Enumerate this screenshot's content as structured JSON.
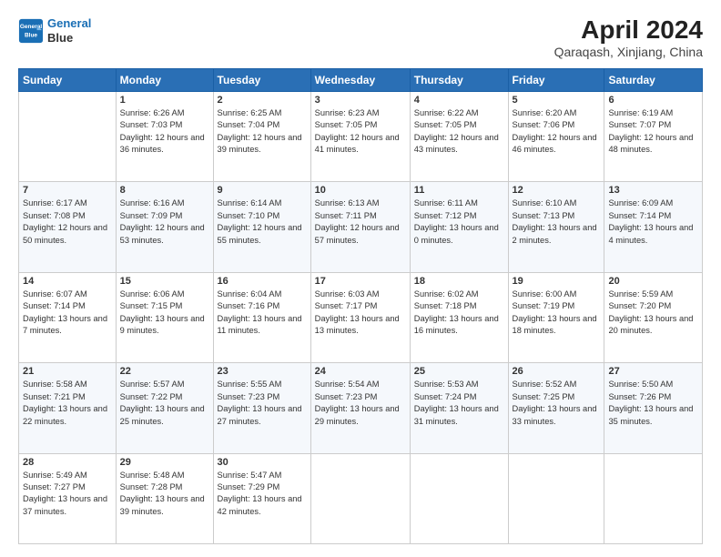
{
  "header": {
    "logo_line1": "General",
    "logo_line2": "Blue",
    "title": "April 2024",
    "subtitle": "Qaraqash, Xinjiang, China"
  },
  "days_of_week": [
    "Sunday",
    "Monday",
    "Tuesday",
    "Wednesday",
    "Thursday",
    "Friday",
    "Saturday"
  ],
  "weeks": [
    [
      {
        "day": null
      },
      {
        "day": 1,
        "sunrise": "6:26 AM",
        "sunset": "7:03 PM",
        "daylight": "12 hours and 36 minutes."
      },
      {
        "day": 2,
        "sunrise": "6:25 AM",
        "sunset": "7:04 PM",
        "daylight": "12 hours and 39 minutes."
      },
      {
        "day": 3,
        "sunrise": "6:23 AM",
        "sunset": "7:05 PM",
        "daylight": "12 hours and 41 minutes."
      },
      {
        "day": 4,
        "sunrise": "6:22 AM",
        "sunset": "7:05 PM",
        "daylight": "12 hours and 43 minutes."
      },
      {
        "day": 5,
        "sunrise": "6:20 AM",
        "sunset": "7:06 PM",
        "daylight": "12 hours and 46 minutes."
      },
      {
        "day": 6,
        "sunrise": "6:19 AM",
        "sunset": "7:07 PM",
        "daylight": "12 hours and 48 minutes."
      }
    ],
    [
      {
        "day": 7,
        "sunrise": "6:17 AM",
        "sunset": "7:08 PM",
        "daylight": "12 hours and 50 minutes."
      },
      {
        "day": 8,
        "sunrise": "6:16 AM",
        "sunset": "7:09 PM",
        "daylight": "12 hours and 53 minutes."
      },
      {
        "day": 9,
        "sunrise": "6:14 AM",
        "sunset": "7:10 PM",
        "daylight": "12 hours and 55 minutes."
      },
      {
        "day": 10,
        "sunrise": "6:13 AM",
        "sunset": "7:11 PM",
        "daylight": "12 hours and 57 minutes."
      },
      {
        "day": 11,
        "sunrise": "6:11 AM",
        "sunset": "7:12 PM",
        "daylight": "13 hours and 0 minutes."
      },
      {
        "day": 12,
        "sunrise": "6:10 AM",
        "sunset": "7:13 PM",
        "daylight": "13 hours and 2 minutes."
      },
      {
        "day": 13,
        "sunrise": "6:09 AM",
        "sunset": "7:14 PM",
        "daylight": "13 hours and 4 minutes."
      }
    ],
    [
      {
        "day": 14,
        "sunrise": "6:07 AM",
        "sunset": "7:14 PM",
        "daylight": "13 hours and 7 minutes."
      },
      {
        "day": 15,
        "sunrise": "6:06 AM",
        "sunset": "7:15 PM",
        "daylight": "13 hours and 9 minutes."
      },
      {
        "day": 16,
        "sunrise": "6:04 AM",
        "sunset": "7:16 PM",
        "daylight": "13 hours and 11 minutes."
      },
      {
        "day": 17,
        "sunrise": "6:03 AM",
        "sunset": "7:17 PM",
        "daylight": "13 hours and 13 minutes."
      },
      {
        "day": 18,
        "sunrise": "6:02 AM",
        "sunset": "7:18 PM",
        "daylight": "13 hours and 16 minutes."
      },
      {
        "day": 19,
        "sunrise": "6:00 AM",
        "sunset": "7:19 PM",
        "daylight": "13 hours and 18 minutes."
      },
      {
        "day": 20,
        "sunrise": "5:59 AM",
        "sunset": "7:20 PM",
        "daylight": "13 hours and 20 minutes."
      }
    ],
    [
      {
        "day": 21,
        "sunrise": "5:58 AM",
        "sunset": "7:21 PM",
        "daylight": "13 hours and 22 minutes."
      },
      {
        "day": 22,
        "sunrise": "5:57 AM",
        "sunset": "7:22 PM",
        "daylight": "13 hours and 25 minutes."
      },
      {
        "day": 23,
        "sunrise": "5:55 AM",
        "sunset": "7:23 PM",
        "daylight": "13 hours and 27 minutes."
      },
      {
        "day": 24,
        "sunrise": "5:54 AM",
        "sunset": "7:23 PM",
        "daylight": "13 hours and 29 minutes."
      },
      {
        "day": 25,
        "sunrise": "5:53 AM",
        "sunset": "7:24 PM",
        "daylight": "13 hours and 31 minutes."
      },
      {
        "day": 26,
        "sunrise": "5:52 AM",
        "sunset": "7:25 PM",
        "daylight": "13 hours and 33 minutes."
      },
      {
        "day": 27,
        "sunrise": "5:50 AM",
        "sunset": "7:26 PM",
        "daylight": "13 hours and 35 minutes."
      }
    ],
    [
      {
        "day": 28,
        "sunrise": "5:49 AM",
        "sunset": "7:27 PM",
        "daylight": "13 hours and 37 minutes."
      },
      {
        "day": 29,
        "sunrise": "5:48 AM",
        "sunset": "7:28 PM",
        "daylight": "13 hours and 39 minutes."
      },
      {
        "day": 30,
        "sunrise": "5:47 AM",
        "sunset": "7:29 PM",
        "daylight": "13 hours and 42 minutes."
      },
      {
        "day": null
      },
      {
        "day": null
      },
      {
        "day": null
      },
      {
        "day": null
      }
    ]
  ]
}
